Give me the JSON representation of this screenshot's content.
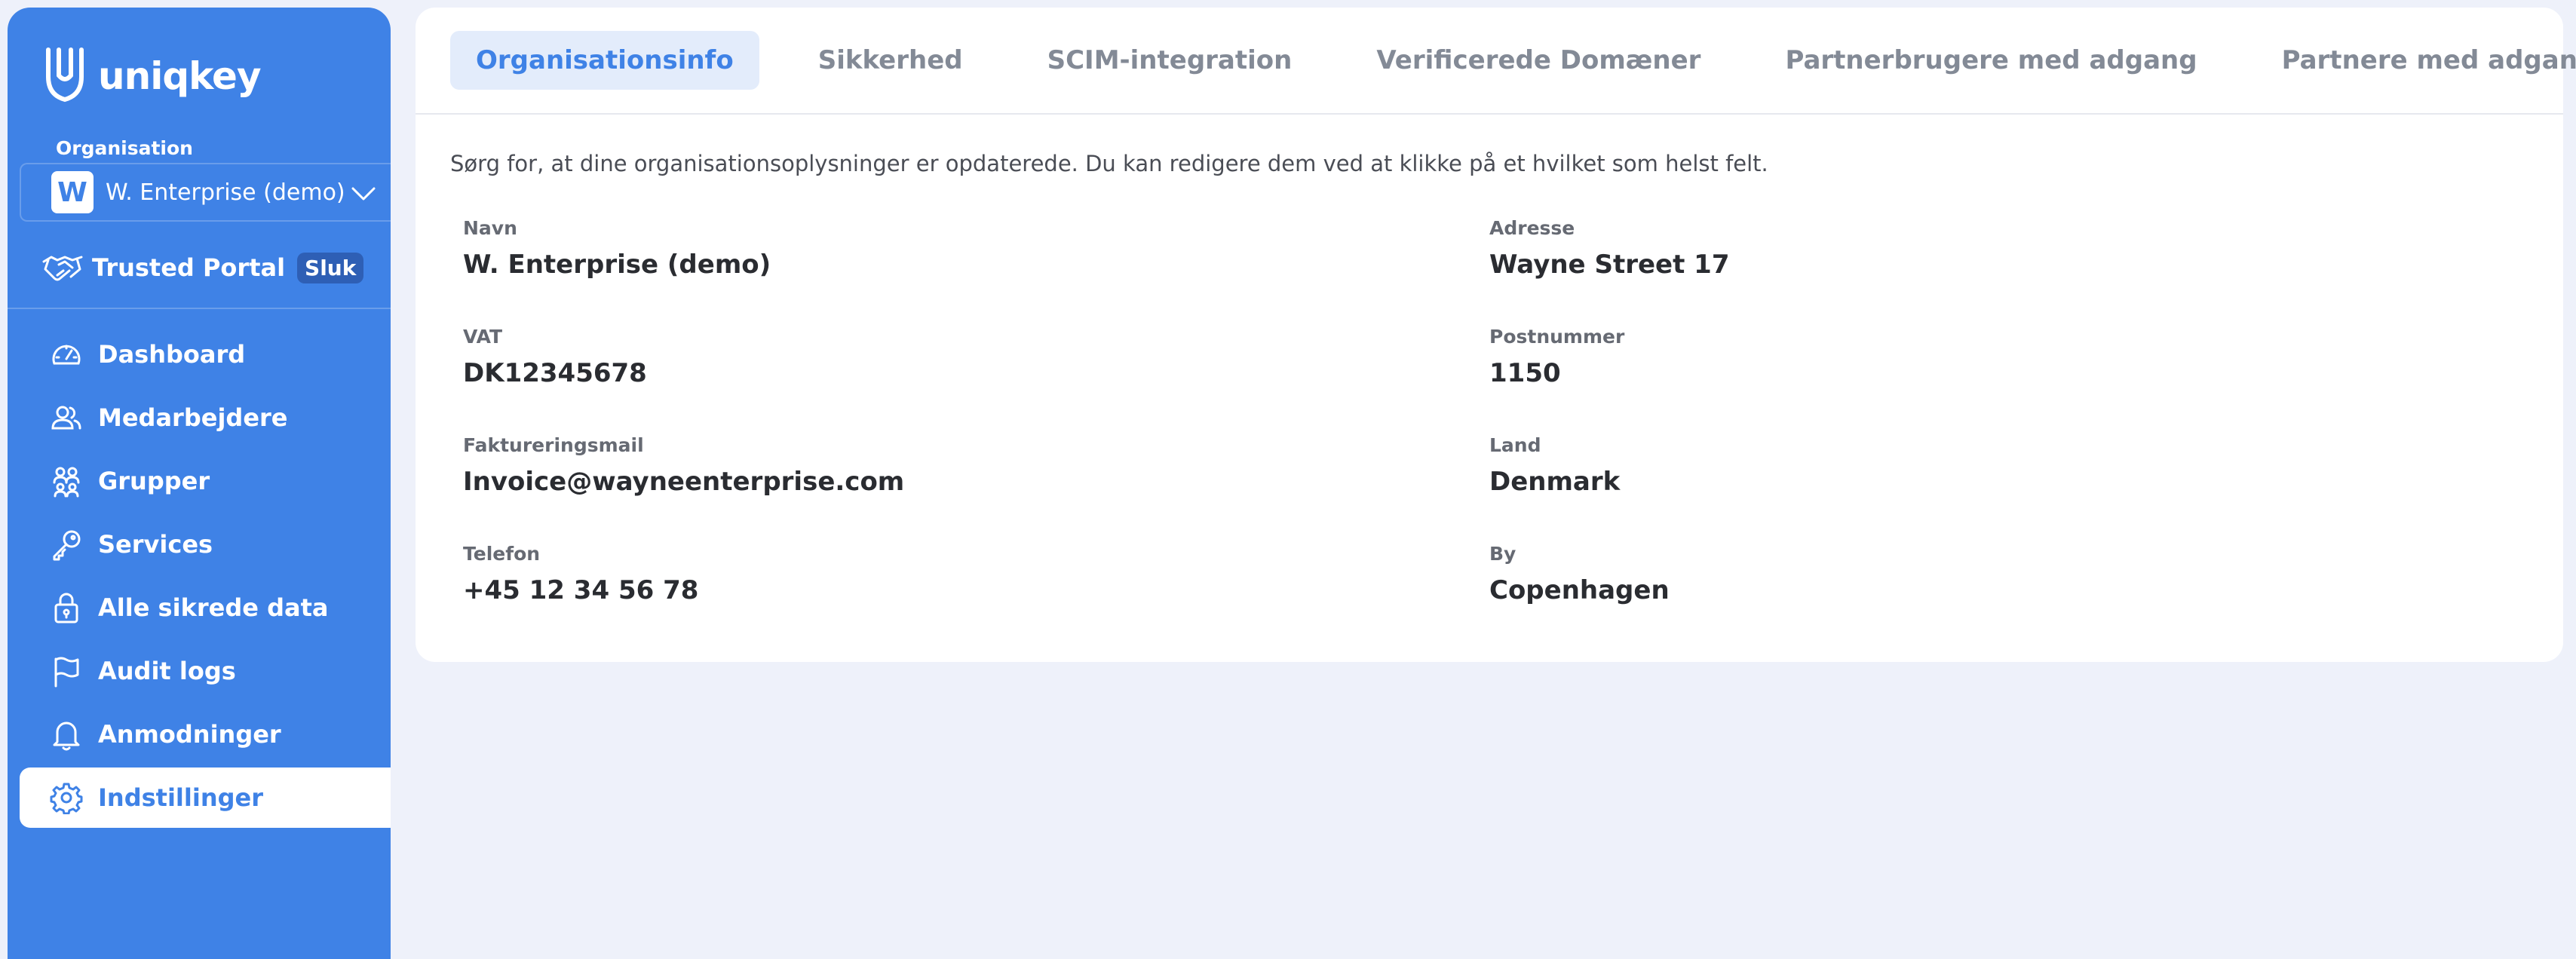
{
  "brand": {
    "name": "uniqkey",
    "accent": "#3f82e6"
  },
  "sidebar": {
    "org_label": "Organisation",
    "org_avatar": "W",
    "org_name": "W. Enterprise (demo)",
    "trusted_label": "Trusted Portal",
    "trusted_badge": "Sluk",
    "items": [
      {
        "label": "Dashboard",
        "icon": "gauge-icon"
      },
      {
        "label": "Medarbejdere",
        "icon": "users-icon"
      },
      {
        "label": "Grupper",
        "icon": "group-icon"
      },
      {
        "label": "Services",
        "icon": "key-icon"
      },
      {
        "label": "Alle sikrede data",
        "icon": "lock-icon"
      },
      {
        "label": "Audit logs",
        "icon": "flag-icon"
      },
      {
        "label": "Anmodninger",
        "icon": "bell-icon"
      },
      {
        "label": "Indstillinger",
        "icon": "gear-icon",
        "active": true
      }
    ]
  },
  "tabs": [
    {
      "label": "Organisationsinfo",
      "active": true
    },
    {
      "label": "Sikkerhed"
    },
    {
      "label": "SCIM-integration"
    },
    {
      "label": "Verificerede Domæner"
    },
    {
      "label": "Partnerbrugere med adgang"
    },
    {
      "label": "Partnere med adgang"
    }
  ],
  "intro": "Sørg for, at dine organisationsoplysninger er opdaterede. Du kan redigere dem ved at klikke på et hvilket som helst felt.",
  "fields": {
    "navn": {
      "label": "Navn",
      "value": "W. Enterprise (demo)"
    },
    "vat": {
      "label": "VAT",
      "value": "DK12345678"
    },
    "faktureringsmail": {
      "label": "Faktureringsmail",
      "value": "Invoice@wayneenterprise.com"
    },
    "telefon": {
      "label": "Telefon",
      "value": "+45 12 34 56 78"
    },
    "adresse": {
      "label": "Adresse",
      "value": "Wayne Street 17"
    },
    "postnummer": {
      "label": "Postnummer",
      "value": "1150"
    },
    "land": {
      "label": "Land",
      "value": "Denmark"
    },
    "by": {
      "label": "By",
      "value": "Copenhagen"
    }
  }
}
